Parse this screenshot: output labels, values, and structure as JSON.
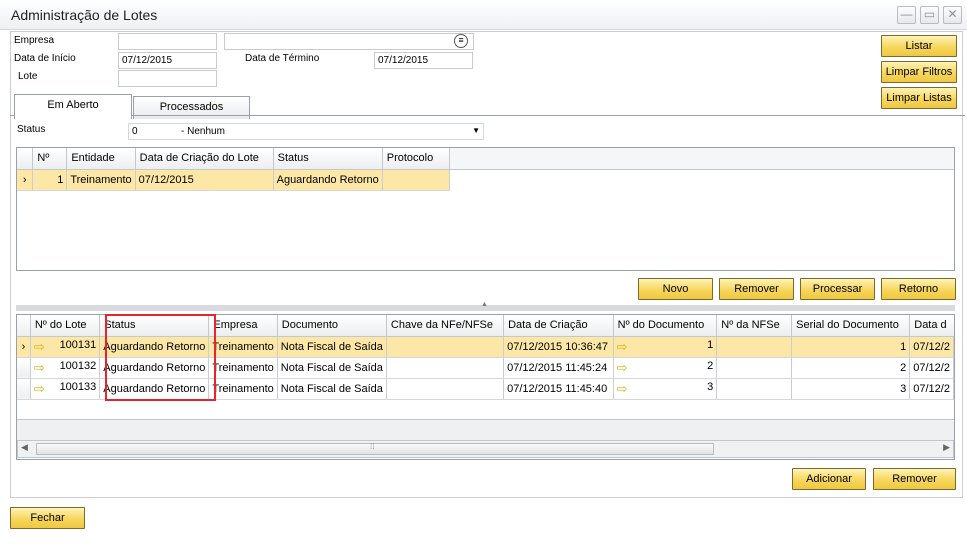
{
  "window": {
    "title": "Administração de Lotes"
  },
  "filters": {
    "empresa_label": "Empresa",
    "empresa_value": "",
    "empresa_name_value": "",
    "data_inicio_label": "Data de Início",
    "data_inicio_value": "07/12/2015",
    "data_termino_label": "Data de Término",
    "data_termino_value": "07/12/2015",
    "lote_label": "Lote",
    "lote_value": ""
  },
  "side_buttons": {
    "listar": "Listar",
    "limpar_filtros": "Limpar Filtros",
    "limpar_listas": "Limpar Listas"
  },
  "tabs": [
    {
      "label": "Em Aberto"
    },
    {
      "label": "Processados"
    }
  ],
  "status_filter": {
    "label": "Status",
    "code": "0",
    "text": "- Nenhum"
  },
  "lotes_grid": {
    "columns": [
      "Nº",
      "Entidade",
      "Data de Criação do Lote",
      "Status",
      "Protocolo"
    ],
    "rows": [
      {
        "num": "1",
        "entidade": "Treinamento",
        "data": "07/12/2015",
        "status": "Aguardando Retorno",
        "protocolo": ""
      }
    ]
  },
  "lote_buttons": {
    "novo": "Novo",
    "remover": "Remover",
    "processar": "Processar",
    "retorno": "Retorno"
  },
  "docs_grid": {
    "columns": [
      "Nº do Lote",
      "Status",
      "Empresa",
      "Documento",
      "Chave da NFe/NFSe",
      "Data de Criação",
      "Nº do Documento",
      "Nº da NFSe",
      "Serial do Documento",
      "Data d"
    ],
    "rows": [
      {
        "lote": "100131",
        "status": "Aguardando Retorno",
        "empresa": "Treinamento",
        "documento": "Nota Fiscal de Saída",
        "chave": "",
        "data": "07/12/2015 10:36:47",
        "num_doc": "1",
        "nfse": "",
        "serial": "1",
        "data2": "07/12/2"
      },
      {
        "lote": "100132",
        "status": "Aguardando Retorno",
        "empresa": "Treinamento",
        "documento": "Nota Fiscal de Saída",
        "chave": "",
        "data": "07/12/2015 11:45:24",
        "num_doc": "2",
        "nfse": "",
        "serial": "2",
        "data2": "07/12/2"
      },
      {
        "lote": "100133",
        "status": "Aguardando Retorno",
        "empresa": "Treinamento",
        "documento": "Nota Fiscal de Saída",
        "chave": "",
        "data": "07/12/2015 11:45:40",
        "num_doc": "3",
        "nfse": "",
        "serial": "3",
        "data2": "07/12/2"
      }
    ]
  },
  "doc_buttons": {
    "adicionar": "Adicionar",
    "remover": "Remover"
  },
  "footer": {
    "fechar": "Fechar"
  },
  "colors": {
    "button_gold": "#f6d65c",
    "selected_row": "#fde7a6",
    "highlight_red": "#e3262d"
  }
}
